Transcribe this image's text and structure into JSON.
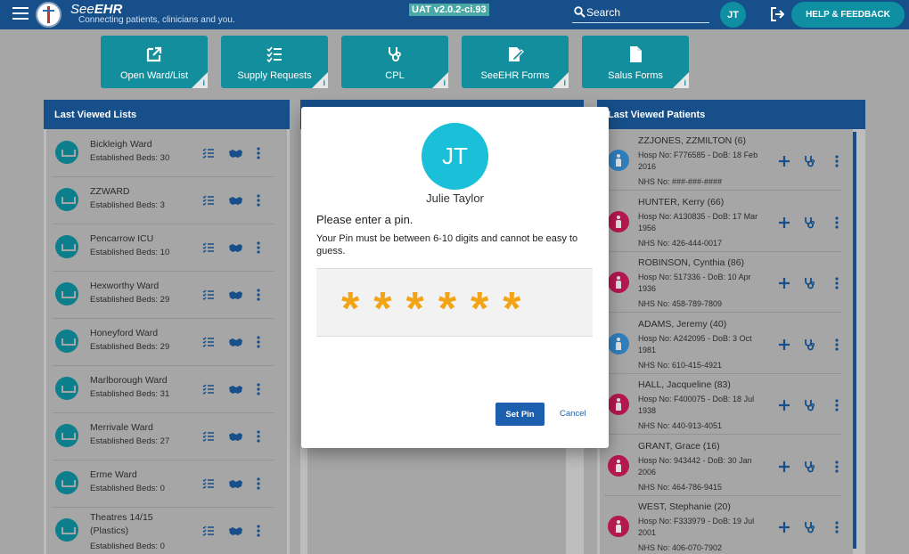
{
  "header": {
    "brand_prefix": "See",
    "brand_suffix": "EHR",
    "tagline": "Connecting patients, clinicians and you.",
    "env_badge": "UAT v2.0.2-ci.93",
    "search_placeholder": "Search",
    "user_initials": "JT",
    "help_label": "HELP & FEEDBACK"
  },
  "tiles": [
    {
      "label": "Open Ward/List",
      "icon": "external-link-icon"
    },
    {
      "label": "Supply Requests",
      "icon": "checklist-icon"
    },
    {
      "label": "CPL",
      "icon": "stethoscope-icon"
    },
    {
      "label": "SeeEHR Forms",
      "icon": "form-edit-icon"
    },
    {
      "label": "Salus Forms",
      "icon": "document-icon"
    }
  ],
  "tile_info": "i",
  "last_viewed_lists": {
    "title": "Last Viewed Lists",
    "items": [
      {
        "name": "Bickleigh Ward",
        "beds": "Established Beds: 30"
      },
      {
        "name": "ZZWARD",
        "beds": "Established Beds: 3"
      },
      {
        "name": "Pencarrow ICU",
        "beds": "Established Beds: 10"
      },
      {
        "name": "Hexworthy Ward",
        "beds": "Established Beds: 29"
      },
      {
        "name": "Honeyford Ward",
        "beds": "Established Beds: 29"
      },
      {
        "name": "Marlborough Ward",
        "beds": "Established Beds: 31"
      },
      {
        "name": "Merrivale Ward",
        "beds": "Established Beds: 27"
      },
      {
        "name": "Erme Ward",
        "beds": "Established Beds: 0"
      },
      {
        "name": "Theatres 14/15 (Plastics)",
        "beds": "Established Beds: 0"
      }
    ]
  },
  "last_viewed_patients": {
    "title": "Last Viewed Patients",
    "items": [
      {
        "name": "ZZJONES, ZZMILTON (6)",
        "hosp": "Hosp No: F776585 - DoB: 18 Feb 2016",
        "nhs": "NHS No: ###-###-####",
        "sex": "male"
      },
      {
        "name": "HUNTER, Kerry (66)",
        "hosp": "Hosp No: A130835 - DoB: 17 Mar 1956",
        "nhs": "NHS No: 426-444-0017",
        "sex": "female"
      },
      {
        "name": "ROBINSON, Cynthia (86)",
        "hosp": "Hosp No: 517336 - DoB: 10 Apr 1936",
        "nhs": "NHS No: 458-789-7809",
        "sex": "female"
      },
      {
        "name": "ADAMS, Jeremy (40)",
        "hosp": "Hosp No: A242095 - DoB: 3 Oct 1981",
        "nhs": "NHS No: 610-415-4921",
        "sex": "male"
      },
      {
        "name": "HALL, Jacqueline (83)",
        "hosp": "Hosp No: F400075 - DoB: 18 Jul 1938",
        "nhs": "NHS No: 440-913-4051",
        "sex": "female"
      },
      {
        "name": "GRANT, Grace (16)",
        "hosp": "Hosp No: 943442 - DoB: 30 Jan 2006",
        "nhs": "NHS No: 464-786-9415",
        "sex": "female"
      },
      {
        "name": "WEST, Stephanie (20)",
        "hosp": "Hosp No: F333979 - DoB: 19 Jul 2001",
        "nhs": "NHS No: 406-070-7902",
        "sex": "female"
      }
    ]
  },
  "pin_dialog": {
    "avatar_initials": "JT",
    "user_name": "Julie Taylor",
    "title": "Please enter a pin.",
    "description": "Your Pin must be between 6-10 digits and cannot be easy to guess.",
    "pin_masked": "******",
    "set_pin_label": "Set Pin",
    "cancel_label": "Cancel"
  },
  "colors": {
    "header": "#164f8a",
    "tile": "#138e9c",
    "pin_star": "#f3a415",
    "primary_button": "#1b5fae",
    "avatar": "#1abfd8",
    "male": "#2f7fbd",
    "female": "#b5174f"
  }
}
